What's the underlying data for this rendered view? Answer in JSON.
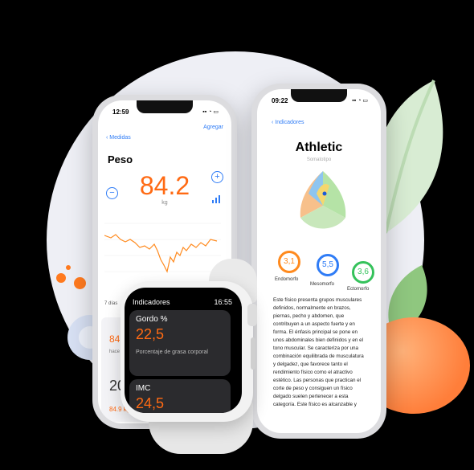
{
  "phone1": {
    "time": "12:59",
    "back_label": "Medidas",
    "add_label": "Agregar",
    "title": "Peso",
    "value": "84.2",
    "unit": "kg",
    "tabs": "7 días",
    "history_value": "84.2",
    "history_sub": "hace 8",
    "card_value": "20",
    "card_value2": "84.9 kg"
  },
  "phone2": {
    "time": "09:22",
    "back_label": "Indicadores",
    "title": "Athletic",
    "subtitle": "Somatotipo",
    "scores": [
      {
        "value": "3,1",
        "label": "Endomorfo"
      },
      {
        "value": "5,5",
        "label": "Mesomorfo"
      },
      {
        "value": "3,6",
        "label": "Ectomorfo"
      }
    ],
    "description": "Este físico presenta grupos musculares definidos, normalmente en brazos, piernas, pecho y abdomen, que contribuyen a un aspecto fuerte y en forma. El énfasis principal se pone en unos abdominales bien definidos y en el tono muscular. Se caracteriza por una combinación equilibrada de musculatura y delgadez, que favorece tanto el rendimiento físico como el atractivo estético. Las personas que practican el corte de peso y consiguen un físico delgado suelen pertenecer a esta categoría. Este físico es alcanzable y"
  },
  "watch": {
    "title": "Indicadores",
    "time": "16:55",
    "card1_label": "Gordo %",
    "card1_value": "22,5",
    "card1_sub": "Porcentaje de grasa corporal",
    "card2_label": "IMC",
    "card2_value": "24,5"
  },
  "colors": {
    "accent_orange": "#ff6a13",
    "accent_blue": "#2f7cf6",
    "accent_green": "#35c25b"
  }
}
